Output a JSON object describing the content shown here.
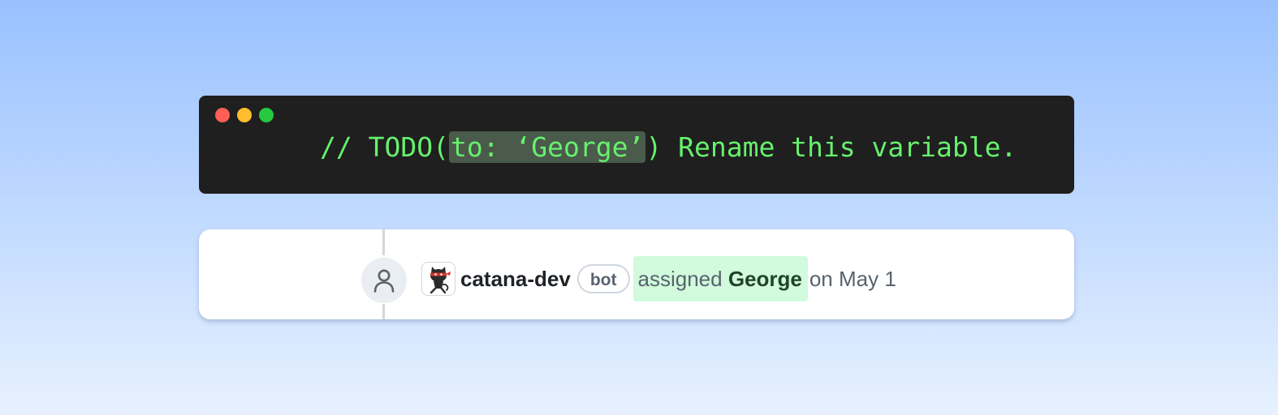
{
  "code_window": {
    "code_prefix": "// TODO(",
    "code_highlight": "to: ‘George’",
    "code_suffix": ") Rename this variable.",
    "colors": {
      "background": "#1f1f1f",
      "code_text": "#67f06d",
      "highlight": "#4a5a4b",
      "close": "#fe5f57",
      "minimize": "#febc2e",
      "zoom": "#28c840"
    }
  },
  "timeline_event": {
    "event_icon": "person-icon",
    "actor_avatar": "ninja-cat-avatar-icon",
    "actor": "catana-dev",
    "actor_badge": "bot",
    "action": "assigned",
    "assignee": "George",
    "when": "on May 1",
    "colors": {
      "highlight": "#d1fbdc",
      "muted_text": "#59636e",
      "actor_text": "#1f2328",
      "assignee_text": "#20432a"
    }
  }
}
